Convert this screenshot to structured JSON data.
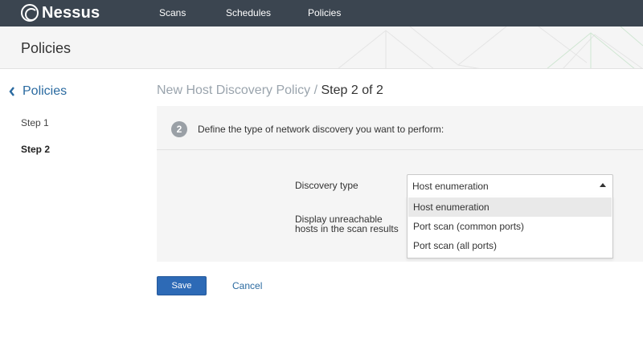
{
  "app": {
    "name": "Nessus"
  },
  "nav": {
    "items": [
      {
        "label": "Scans"
      },
      {
        "label": "Schedules"
      },
      {
        "label": "Policies"
      }
    ]
  },
  "header": {
    "title": "Policies"
  },
  "sidebar": {
    "back_label": "Policies",
    "steps": [
      {
        "label": "Step 1",
        "active": false
      },
      {
        "label": "Step 2",
        "active": true
      }
    ]
  },
  "main": {
    "title_prefix": "New Host Discovery Policy /",
    "title_step": "Step 2 of 2",
    "step_number": "2",
    "step_description": "Define the type of network discovery you want to perform:",
    "discovery_label": "Discovery type",
    "unreachable_label_line1": "Display unreachable",
    "unreachable_label_line2": "hosts in the scan results",
    "discovery_select": {
      "value": "Host enumeration",
      "open": true,
      "options": [
        "Host enumeration",
        "Port scan (common ports)",
        "Port scan (all ports)"
      ],
      "highlighted_index": 0
    }
  },
  "actions": {
    "save_label": "Save",
    "cancel_label": "Cancel"
  },
  "colors": {
    "topnav": "#3b4550",
    "accent": "#2d6ab6",
    "link": "#2a6aa0",
    "panel": "#f5f5f5"
  },
  "icons": {
    "logo": "nessus-logo-icon",
    "back": "chevron-left-icon",
    "select": "caret-up-icon"
  }
}
